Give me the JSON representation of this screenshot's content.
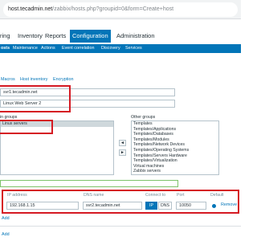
{
  "browser": {
    "url_host": "host.tecadmin.net",
    "url_path": "/zabbix/hosts.php?groupid=0&form=Create+host"
  },
  "topnav": {
    "items": [
      "ring",
      "Inventory",
      "Reports",
      "Configuration",
      "Administration"
    ]
  },
  "subnav": {
    "items": [
      "osts",
      "Maintenance",
      "Actions",
      "Event correlation",
      "Discovery",
      "Services"
    ]
  },
  "tabs": {
    "items": [
      "Macros",
      "Host inventory",
      "Encryption"
    ]
  },
  "host": {
    "host_name": "svr1.tecadmin.net",
    "visible_name": "Linux Web Server 2"
  },
  "groups": {
    "in_groups_label": "in groups",
    "in_groups": [
      "Linux servers"
    ],
    "other_groups_label": "Other groups",
    "other_groups": [
      "Templates",
      "Templates/Applications",
      "Templates/Databases",
      "Templates/Modules",
      "Templates/Network Devices",
      "Templates/Operating Systems",
      "Templates/Servers Hardware",
      "Templates/Virtualization",
      "Virtual machines",
      "Zabbix servers"
    ],
    "move_left": "◄",
    "move_right": "►"
  },
  "interface": {
    "headers": {
      "ip": "IP address",
      "dns": "DNS name",
      "connect_to": "Connect to",
      "port": "Port",
      "default": "Default"
    },
    "ip_value": "192.168.1.15",
    "dns_value": "svr2.tecadmin.net",
    "connect_ip": "IP",
    "connect_dns": "DNS",
    "port_value": "10050",
    "remove": "Remove"
  },
  "links": {
    "add_upper": "Add",
    "add_lower": "Add"
  }
}
